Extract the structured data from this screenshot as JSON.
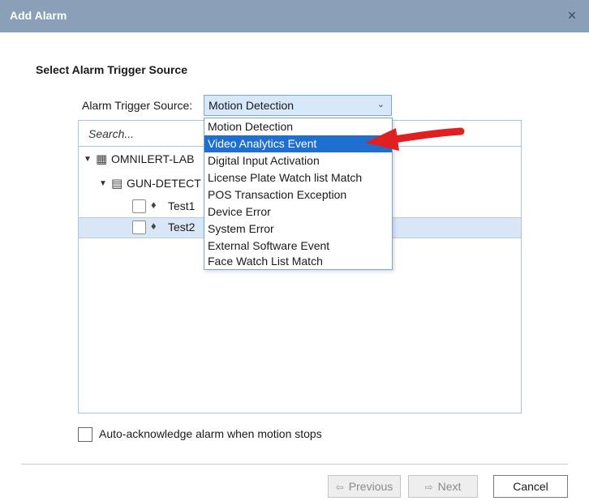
{
  "window": {
    "title": "Add Alarm",
    "close_glyph": "×"
  },
  "section_title": "Select Alarm Trigger Source",
  "trigger": {
    "label": "Alarm Trigger Source:",
    "selected": "Motion Detection",
    "options": [
      "Motion Detection",
      "Video Analytics Event",
      "Digital Input Activation",
      "License Plate Watch list Match",
      "POS Transaction Exception",
      "Device Error",
      "System Error",
      "External Software Event",
      "Face Watch List Match"
    ],
    "highlighted_index": 1
  },
  "search": {
    "placeholder": "Search..."
  },
  "tree": {
    "root": "OMNILERT-LAB",
    "child": "GUN-DETECT",
    "items": [
      "Test1",
      "Test2"
    ]
  },
  "auto_ack_label": "Auto-acknowledge alarm when motion stops",
  "buttons": {
    "previous": "Previous",
    "next": "Next",
    "cancel": "Cancel"
  },
  "colors": {
    "titlebar": "#8a9fb8",
    "highlight": "#1f6fd1",
    "arrow": "#e02020",
    "selected_row": "#d8e6f5"
  }
}
